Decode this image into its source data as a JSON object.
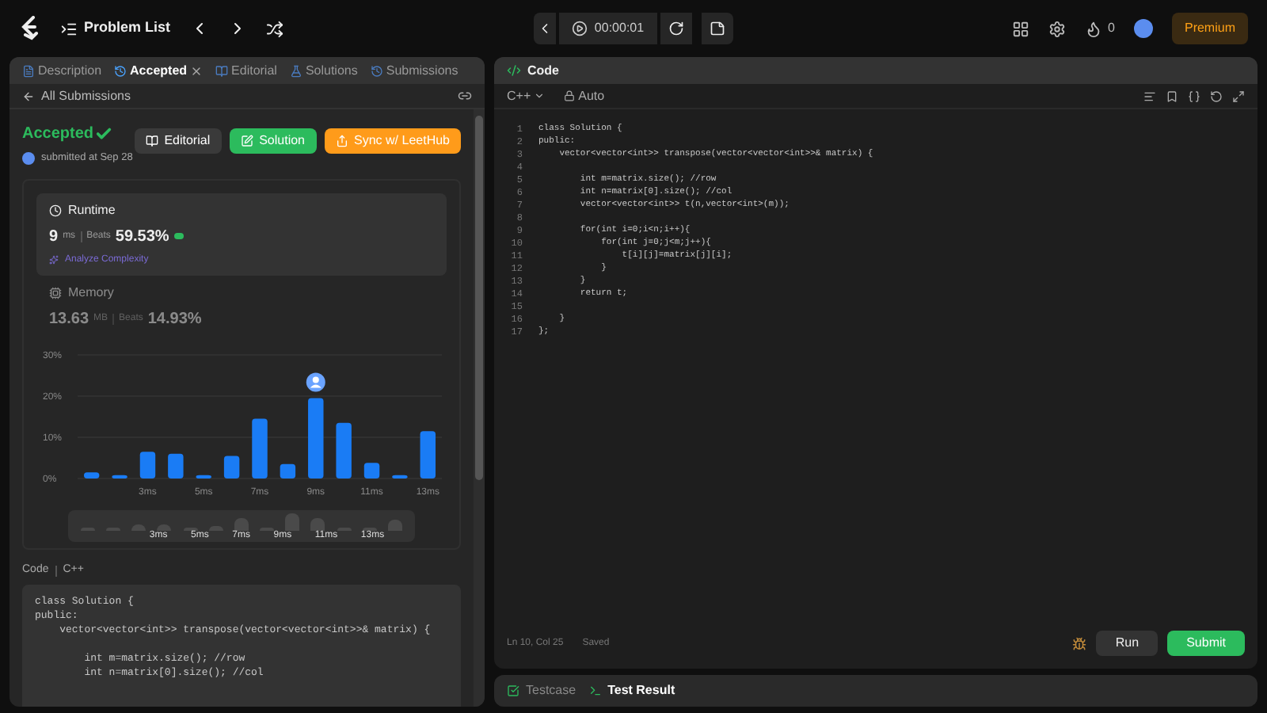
{
  "topbar": {
    "title": "Problem List",
    "timer": "00:00:01",
    "streak": "0",
    "premium": "Premium"
  },
  "left_tabs": [
    {
      "label": "Description",
      "selected": false,
      "closable": false
    },
    {
      "label": "Accepted",
      "selected": true,
      "closable": true
    },
    {
      "label": "Editorial",
      "selected": false,
      "closable": false
    },
    {
      "label": "Solutions",
      "selected": false,
      "closable": false
    },
    {
      "label": "Submissions",
      "selected": false,
      "closable": false
    }
  ],
  "back_link": "All Submissions",
  "result": {
    "status": "Accepted",
    "submitted": "submitted at Sep 28"
  },
  "actions": [
    {
      "label": "Editorial",
      "kind": "neutral"
    },
    {
      "label": "Solution",
      "kind": "green"
    },
    {
      "label": "Sync w/ LeetHub",
      "kind": "orange"
    }
  ],
  "metrics": [
    {
      "kind": "runtime",
      "title": "Runtime",
      "value": "9",
      "unit": "ms",
      "beats_label": "Beats",
      "beats": "59.53%",
      "link": "Analyze Complexity",
      "selected": true
    },
    {
      "kind": "memory",
      "title": "Memory",
      "value": "13.63",
      "unit": "MB",
      "beats_label": "Beats",
      "beats": "14.93%",
      "selected": false
    }
  ],
  "chart_data": {
    "type": "bar",
    "x": [
      1,
      2,
      3,
      4,
      5,
      6,
      7,
      8,
      9,
      10,
      11,
      12,
      13
    ],
    "xlim": [
      0.5,
      13.5
    ],
    "series": [
      {
        "color": "#1a7cf5",
        "values": [
          1.5,
          0.8,
          6.5,
          6,
          0.8,
          5.5,
          14.5,
          3.5,
          19.5,
          13.5,
          3.8,
          0.8,
          11.5
        ]
      }
    ],
    "ylim": [
      0,
      30
    ],
    "yticks": [
      {
        "value": 0,
        "label": "0%"
      },
      {
        "value": 10,
        "label": "10%"
      },
      {
        "value": 20,
        "label": "20%"
      },
      {
        "value": 30,
        "label": "30%"
      }
    ],
    "xticks": [
      {
        "value": 3,
        "label": "3ms"
      },
      {
        "value": 5,
        "label": "5ms"
      },
      {
        "value": 7,
        "label": "7ms"
      },
      {
        "value": 9,
        "label": "9ms"
      },
      {
        "value": 11,
        "label": "11ms"
      },
      {
        "value": 13,
        "label": "13ms"
      }
    ]
  },
  "brush_labels": [
    "3ms",
    "5ms",
    "7ms",
    "9ms",
    "11ms",
    "13ms"
  ],
  "code_section": {
    "label": "Code",
    "language": "C++",
    "lines": [
      {
        "kind": "code",
        "text": "class Solution {"
      },
      {
        "kind": "code",
        "text": "public:"
      },
      {
        "kind": "code",
        "text": "    vector<vector<int>> transpose(vector<vector<int>>& matrix) {"
      },
      {
        "kind": "blank"
      },
      {
        "kind": "code",
        "text": "        int m=matrix.size(); //row"
      },
      {
        "kind": "code",
        "text": "        int n=matrix[0].size(); //col"
      }
    ]
  },
  "editor": {
    "tab": "Code",
    "language": "C++",
    "mode": "Auto",
    "lines": [
      {
        "number": "1",
        "text": "class Solution {"
      },
      {
        "number": "2",
        "text": "public:"
      },
      {
        "number": "3",
        "text": "    vector<vector<int>> transpose(vector<vector<int>>& matrix) {"
      },
      {
        "number": "4"
      },
      {
        "number": "5",
        "text": "        int m=matrix.size(); //row"
      },
      {
        "number": "6",
        "text": "        int n=matrix[0].size(); //col"
      },
      {
        "number": "7",
        "text": "        vector<vector<int>> t(n,vector<int>(m));"
      },
      {
        "number": "8"
      },
      {
        "number": "9",
        "text": "        for(int i=0;i<n;i++){"
      },
      {
        "number": "10",
        "text": "            for(int j=0;j<m;j++){"
      },
      {
        "number": "11",
        "text": "                t[i][j]=matrix[j][i];"
      },
      {
        "number": "12",
        "text": "            }"
      },
      {
        "number": "13",
        "text": "        }"
      },
      {
        "number": "14",
        "text": "        return t;"
      },
      {
        "number": "15"
      },
      {
        "number": "16",
        "text": "    }"
      },
      {
        "number": "17",
        "text": "};"
      }
    ],
    "status": "Ln 10, Col 25",
    "saved": "Saved",
    "run": "Run",
    "submit": "Submit"
  },
  "bottom_tabs": [
    {
      "label": "Testcase",
      "selected": false
    },
    {
      "label": "Test Result",
      "selected": true
    }
  ]
}
